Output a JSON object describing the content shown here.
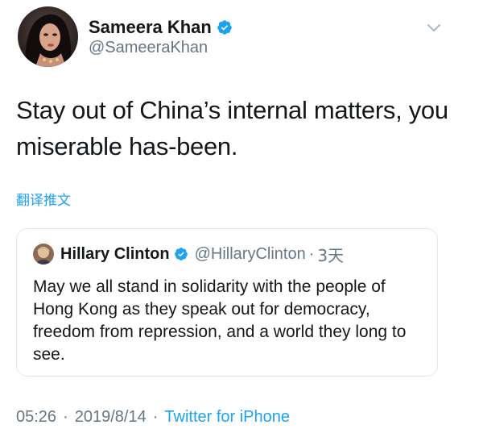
{
  "author": {
    "display_name": "Sameera Khan",
    "handle": "@SameeraKhan",
    "verified": true,
    "avatar_icon": "profile-photo-avatar"
  },
  "tweet": {
    "text": "Stay out of China’s internal matters, you miserable has-been.",
    "translate_label": "翻译推文"
  },
  "quoted_tweet": {
    "display_name": "Hillary Clinton",
    "handle": "@HillaryClinton",
    "separator": "·",
    "relative_time": "3天",
    "verified": true,
    "text": "May we all stand in solidarity with the people of Hong Kong as they speak out for democracy, freedom from repression, and a world they long to see."
  },
  "meta": {
    "time": "05:26",
    "separator": "·",
    "date": "2019/8/14",
    "source": "Twitter for iPhone"
  },
  "colors": {
    "text_primary": "#14171a",
    "text_secondary": "#657786",
    "link_blue": "#1da1f2",
    "border": "#e1e8ed"
  },
  "icons": {
    "verified": "verified-badge-icon",
    "caret": "chevron-down-icon"
  }
}
